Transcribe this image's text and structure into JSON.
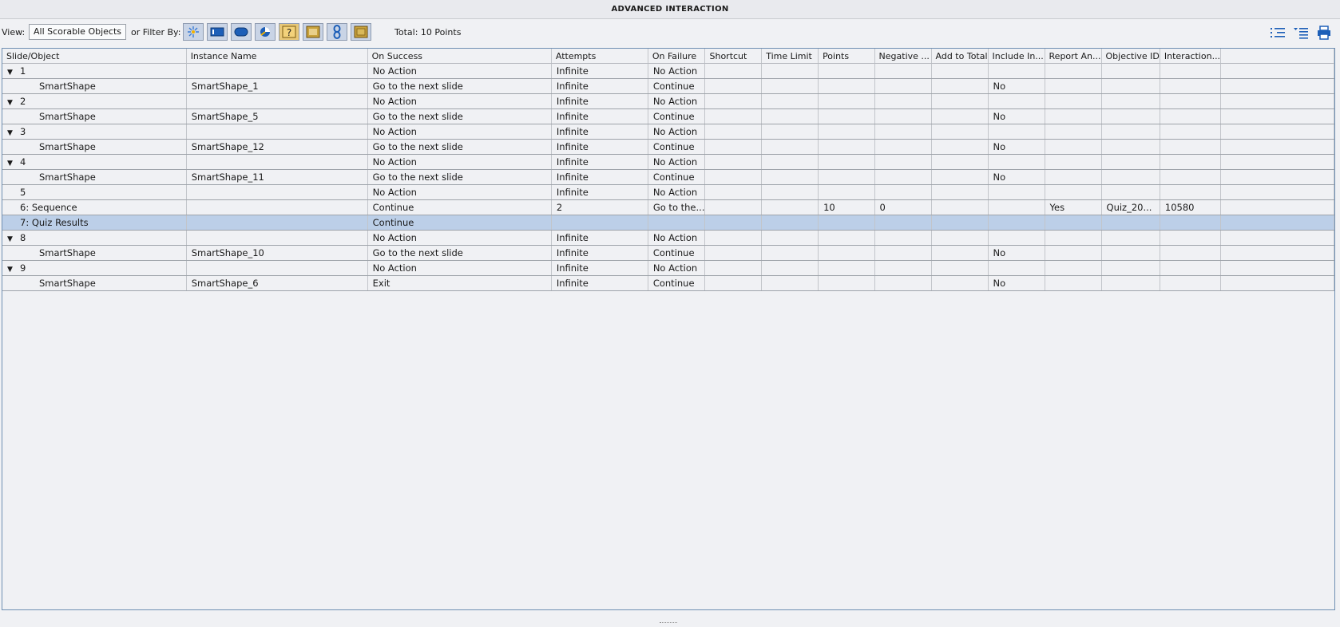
{
  "window": {
    "title": "ADVANCED INTERACTION"
  },
  "toolbar": {
    "view_label": "View:",
    "view_value": "All Scorable Objects",
    "filter_label": "or Filter By:",
    "filters": [
      "pointer-icon",
      "text-entry-icon",
      "button-icon",
      "click-box-icon",
      "question-icon",
      "image-icon",
      "hyperlink-icon",
      "smart-shape-icon"
    ],
    "total": "Total: 10 Points"
  },
  "columns": [
    "Slide/Object",
    "Instance Name",
    "On Success",
    "Attempts",
    "On Failure",
    "Shortcut",
    "Time Limit",
    "Points",
    "Negative ...",
    "Add to Total",
    "Include In...",
    "Report An...",
    "Objective ID",
    "Interaction...",
    ""
  ],
  "rows": [
    {
      "slide": "1",
      "expand": "▼",
      "child": false,
      "cells": [
        "",
        "No Action",
        "Infinite",
        "No Action",
        "",
        "",
        "",
        "",
        "",
        "",
        "",
        "",
        ""
      ]
    },
    {
      "slide": "SmartShape",
      "expand": "",
      "child": true,
      "cells": [
        "SmartShape_1",
        "Go to the next slide",
        "Infinite",
        "Continue",
        "",
        "",
        "",
        "",
        "",
        "No",
        "",
        "",
        ""
      ]
    },
    {
      "slide": "2",
      "expand": "▼",
      "child": false,
      "cells": [
        "",
        "No Action",
        "Infinite",
        "No Action",
        "",
        "",
        "",
        "",
        "",
        "",
        "",
        "",
        ""
      ]
    },
    {
      "slide": "SmartShape",
      "expand": "",
      "child": true,
      "cells": [
        "SmartShape_5",
        "Go to the next slide",
        "Infinite",
        "Continue",
        "",
        "",
        "",
        "",
        "",
        "No",
        "",
        "",
        ""
      ]
    },
    {
      "slide": "3",
      "expand": "▼",
      "child": false,
      "cells": [
        "",
        "No Action",
        "Infinite",
        "No Action",
        "",
        "",
        "",
        "",
        "",
        "",
        "",
        "",
        ""
      ]
    },
    {
      "slide": "SmartShape",
      "expand": "",
      "child": true,
      "cells": [
        "SmartShape_12",
        "Go to the next slide",
        "Infinite",
        "Continue",
        "",
        "",
        "",
        "",
        "",
        "No",
        "",
        "",
        ""
      ]
    },
    {
      "slide": "4",
      "expand": "▼",
      "child": false,
      "cells": [
        "",
        "No Action",
        "Infinite",
        "No Action",
        "",
        "",
        "",
        "",
        "",
        "",
        "",
        "",
        ""
      ]
    },
    {
      "slide": "SmartShape",
      "expand": "",
      "child": true,
      "cells": [
        "SmartShape_11",
        "Go to the next slide",
        "Infinite",
        "Continue",
        "",
        "",
        "",
        "",
        "",
        "No",
        "",
        "",
        ""
      ]
    },
    {
      "slide": "5",
      "expand": "",
      "child": false,
      "cells": [
        "",
        "No Action",
        "Infinite",
        "No Action",
        "",
        "",
        "",
        "",
        "",
        "",
        "",
        "",
        ""
      ]
    },
    {
      "slide": "6: Sequence",
      "expand": "",
      "child": false,
      "cells": [
        "",
        "Continue",
        "2",
        "Go to the...",
        "",
        "",
        "10",
        "0",
        "",
        "",
        "Yes",
        "Quiz_20...",
        "10580"
      ]
    },
    {
      "slide": "7: Quiz Results",
      "expand": "",
      "child": false,
      "selected": true,
      "cells": [
        "",
        "Continue",
        "",
        "",
        "",
        "",
        "",
        "",
        "",
        "",
        "",
        "",
        ""
      ]
    },
    {
      "slide": "8",
      "expand": "▼",
      "child": false,
      "cells": [
        "",
        "No Action",
        "Infinite",
        "No Action",
        "",
        "",
        "",
        "",
        "",
        "",
        "",
        "",
        ""
      ]
    },
    {
      "slide": "SmartShape",
      "expand": "",
      "child": true,
      "cells": [
        "SmartShape_10",
        "Go to the next slide",
        "Infinite",
        "Continue",
        "",
        "",
        "",
        "",
        "",
        "No",
        "",
        "",
        ""
      ]
    },
    {
      "slide": "9",
      "expand": "▼",
      "child": false,
      "cells": [
        "",
        "No Action",
        "Infinite",
        "No Action",
        "",
        "",
        "",
        "",
        "",
        "",
        "",
        "",
        ""
      ]
    },
    {
      "slide": "SmartShape",
      "expand": "",
      "child": true,
      "cells": [
        "SmartShape_6",
        "Exit",
        "Infinite",
        "Continue",
        "",
        "",
        "",
        "",
        "",
        "No",
        "",
        "",
        ""
      ]
    }
  ],
  "right_icons": [
    "outline-view-icon",
    "collapse-view-icon",
    "print-icon"
  ]
}
